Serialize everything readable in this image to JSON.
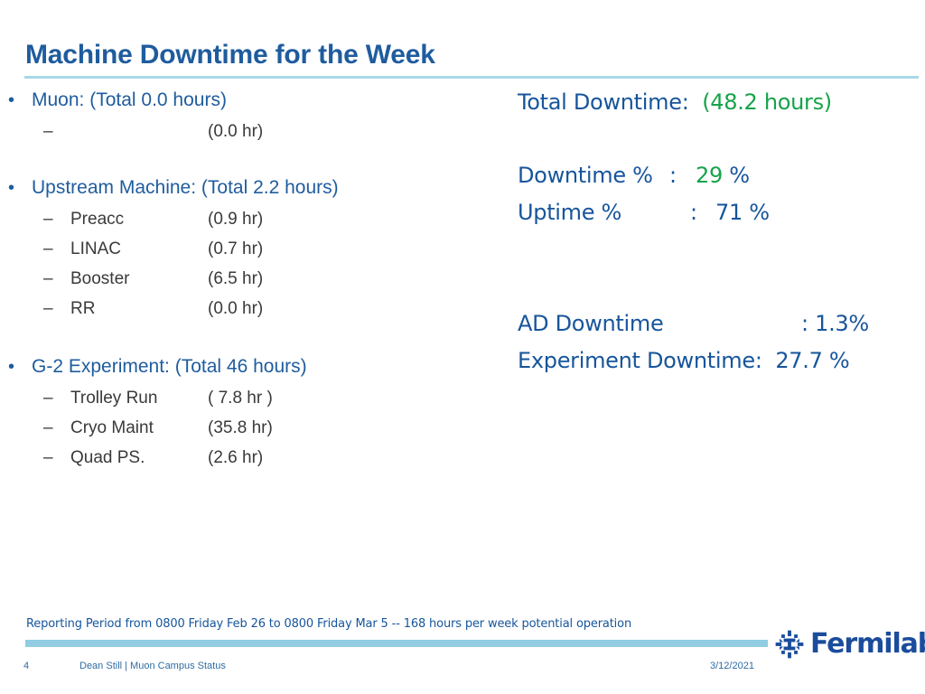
{
  "slide": {
    "title": "Machine Downtime for the Week",
    "page_number": "4",
    "author_line": "Dean Still | Muon Campus Status",
    "date": "3/12/2021",
    "reporting_note": "Reporting Period from 0800 Friday Feb 26 to 0800 Friday Mar 5   -- 168 hours per week potential operation",
    "logo_text": "Fermilab"
  },
  "colors": {
    "title_blue": "#1F5C9E",
    "body_blue": "#17559B",
    "accent_green": "#16A34A",
    "rule_light_blue": "#A7D8E8",
    "footer_bar_blue": "#92CDE4",
    "sub_text_gray": "#3A3A3A"
  },
  "left_column": {
    "groups": [
      {
        "bullet": "•",
        "heading": "Muon:  (Total 0.0 hours)",
        "items": [
          {
            "dash": "–",
            "label": "",
            "value": "(0.0 hr)"
          }
        ]
      },
      {
        "bullet": "•",
        "heading": "Upstream Machine:  (Total 2.2 hours)",
        "items": [
          {
            "dash": "–",
            "label": "Preacc",
            "value": "(0.9 hr)"
          },
          {
            "dash": "–",
            "label": "LINAC",
            "value": "(0.7 hr)"
          },
          {
            "dash": "–",
            "label": "Booster",
            "value": "(6.5 hr)"
          },
          {
            "dash": "–",
            "label": "RR",
            "value": "(0.0  hr)"
          }
        ]
      },
      {
        "bullet": "•",
        "heading": "G-2 Experiment: (Total 46 hours)",
        "items": [
          {
            "dash": "–",
            "label": "Trolley Run",
            "value": "( 7.8 hr )"
          },
          {
            "dash": "–",
            "label": "Cryo Maint",
            "value": "(35.8 hr)"
          },
          {
            "dash": "–",
            "label": "Quad PS.",
            "value": "(2.6 hr)"
          }
        ]
      }
    ]
  },
  "right_column": {
    "total_downtime_label": "Total Downtime:",
    "total_downtime_value": "(48.2 hours)",
    "downtime_pct_label": "Downtime %",
    "downtime_pct_colon": ":",
    "downtime_pct_value": "29",
    "downtime_pct_unit": "%",
    "uptime_pct_label": "Uptime %",
    "uptime_pct_colon": ":",
    "uptime_pct_value": "71 %",
    "ad_downtime_label": "AD Downtime",
    "ad_downtime_value": ": 1.3%",
    "experiment_downtime_label": "Experiment Downtime:",
    "experiment_downtime_value": "27.7 %"
  }
}
